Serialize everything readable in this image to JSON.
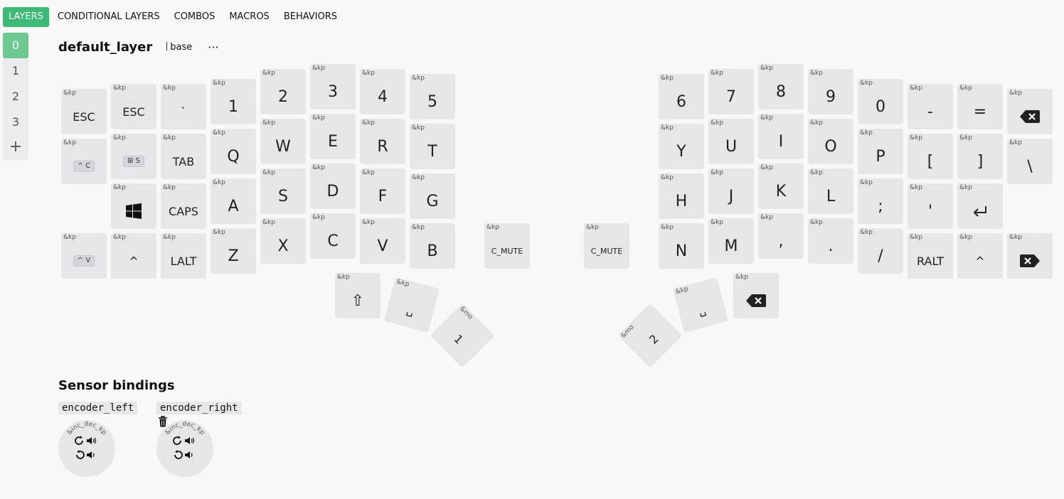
{
  "nav": {
    "tabs": [
      "LAYERS",
      "CONDITIONAL LAYERS",
      "COMBOS",
      "MACROS",
      "BEHAVIORS"
    ],
    "active": 0
  },
  "layers": {
    "items": [
      "0",
      "1",
      "2",
      "3"
    ],
    "active": 0,
    "add_label": "+"
  },
  "layer_header": {
    "name": "default_layer",
    "base": "base",
    "menu": "···"
  },
  "keys": {
    "behavior": "&kp",
    "behavior_mo": "&mo",
    "left_thumb": {
      "shift": "⇧",
      "space": "␣",
      "mo1": "1"
    },
    "right_thumb": {
      "mo2": "2",
      "space": "␣"
    },
    "labels": {
      "esc": "ESC",
      "grave": "`",
      "tab": "TAB",
      "caps": "CAPS",
      "lalt": "LALT",
      "n1": "1",
      "n2": "2",
      "n3": "3",
      "n4": "4",
      "n5": "5",
      "q": "Q",
      "w": "W",
      "e": "E",
      "r": "R",
      "t": "T",
      "a": "A",
      "s": "S",
      "d": "D",
      "f": "F",
      "g": "G",
      "z": "Z",
      "x": "X",
      "c": "C",
      "v": "V",
      "b": "B",
      "caret": "^",
      "c_mute": "C_MUTE",
      "n6": "6",
      "n7": "7",
      "n8": "8",
      "n9": "9",
      "n0": "0",
      "minus": "-",
      "equal": "=",
      "y": "Y",
      "u": "U",
      "i": "I",
      "o": "O",
      "p": "P",
      "lbracket": "[",
      "rbracket": "]",
      "backslash": "\\",
      "h": "H",
      "j": "J",
      "k": "K",
      "l": "L",
      "semicolon": ";",
      "quote": "'",
      "n": "N",
      "m": "M",
      "comma": ",",
      "dot": ".",
      "slash": "/",
      "ralt": "RALT"
    },
    "chips": {
      "ctrl_c": "^ C",
      "ctrl_v": "^ V",
      "win_s": "S"
    }
  },
  "sensor": {
    "title": "Sensor bindings",
    "encoders": [
      {
        "name": "encoder_left",
        "behavior": "&inc_dec_kp"
      },
      {
        "name": "encoder_right",
        "behavior": "&inc_dec_kp"
      }
    ]
  },
  "colors": {
    "accent": "#3eb875",
    "key_bg": "#e6e6e9",
    "layer_active": "#6cc990"
  }
}
